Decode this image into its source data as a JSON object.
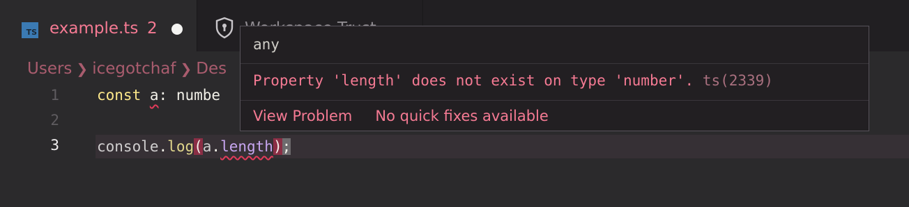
{
  "tabs": [
    {
      "label": "example.ts",
      "problems": "2",
      "icon": "typescript-file-icon",
      "icon_text": "TS",
      "dirty": true
    },
    {
      "label": "Workspace Trust",
      "icon": "shield-icon"
    }
  ],
  "breadcrumb": [
    "Users",
    "icegotchaf",
    "Des"
  ],
  "editor": {
    "line_numbers": [
      "1",
      "2",
      "3"
    ],
    "line1": {
      "keyword": "const",
      "var": "a",
      "rest": ": numbe"
    },
    "line3": {
      "obj": "console",
      "method": "log",
      "arg_obj": "a",
      "arg_prop": "length"
    }
  },
  "hover": {
    "type": "any",
    "message": "Property 'length' does not exist on type 'number'.",
    "code": "ts(2339)",
    "view_problem": "View Problem",
    "no_fixes": "No quick fixes available"
  },
  "colors": {
    "error": "#f57a93",
    "background": "#2b2a2c",
    "tabbar": "#211f22"
  }
}
